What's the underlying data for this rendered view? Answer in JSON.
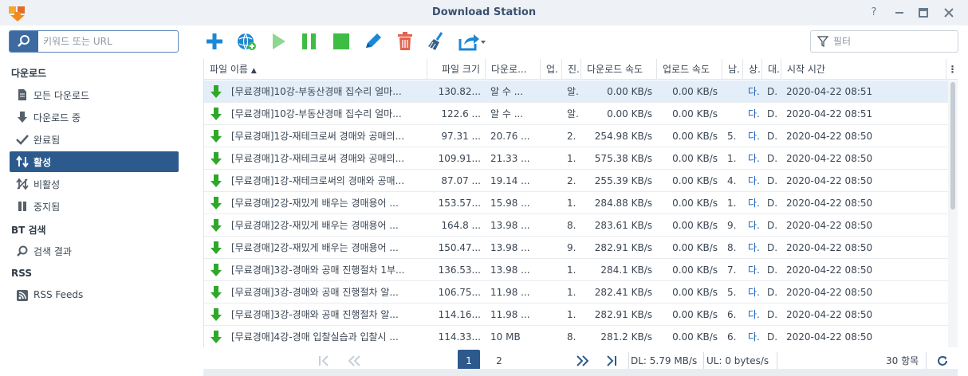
{
  "window": {
    "title": "Download Station"
  },
  "colors": {
    "accent": "#2d5a8c",
    "play_green": "#3dbd44",
    "add_blue": "#1b87d6",
    "trash_red": "#e4624f",
    "arrow_green": "#2fa82a"
  },
  "search": {
    "placeholder": "키워드 또는 URL"
  },
  "filter": {
    "placeholder": "필터"
  },
  "sidebar": {
    "section_download": "다운로드",
    "items": [
      {
        "label": "모든 다운로드",
        "icon": "document-icon"
      },
      {
        "label": "다운로드 중",
        "icon": "down-arrow-icon"
      },
      {
        "label": "완료됨",
        "icon": "check-icon"
      },
      {
        "label": "활성",
        "icon": "up-down-arrows-icon"
      },
      {
        "label": "비활성",
        "icon": "no-transfer-icon"
      },
      {
        "label": "중지됨",
        "icon": "pause-icon"
      }
    ],
    "section_bt": "BT 검색",
    "bt_items": [
      {
        "label": "검색 결과",
        "icon": "magnifier-icon"
      }
    ],
    "section_rss": "RSS",
    "rss_items": [
      {
        "label": "RSS Feeds",
        "icon": "rss-icon"
      }
    ]
  },
  "table": {
    "columns": [
      "파일 이름",
      "파일 크기",
      "다운로...",
      "업.",
      "진.",
      "다운로드 속도",
      "업로드 속도",
      "남.",
      "상.",
      "대.",
      "시작 시간"
    ],
    "sort_indicator": "▲",
    "rows": [
      [
        "[무료경매]10강-부동산경매 집수리 얼마...",
        "130.82...",
        "알 수 ...",
        "",
        "알.",
        "0.00 KB/s",
        "0.00 KB/s",
        "",
        "다.",
        "D.",
        "2020-04-22 08:51"
      ],
      [
        "[무료경매]10강-부동산경매 집수리 얼마...",
        "122.6 ...",
        "알 수 ...",
        "",
        "알.",
        "0.00 KB/s",
        "0.00 KB/s",
        "",
        "다.",
        "D.",
        "2020-04-22 08:51"
      ],
      [
        "[무료경매]1강-재테크로써 경매와 공매의...",
        "97.31 ...",
        "20.76 ...",
        "",
        "2.",
        "254.98 KB/s",
        "0.00 KB/s",
        "5.",
        "다.",
        "D.",
        "2020-04-22 08:50"
      ],
      [
        "[무료경매]1강-재테크로써 경매와 공매의...",
        "109.91...",
        "21.33 ...",
        "",
        "1.",
        "575.38 KB/s",
        "0.00 KB/s",
        "1.",
        "다.",
        "D.",
        "2020-04-22 08:50"
      ],
      [
        "[무료경매]1강-재테크로써의 경매와 공매...",
        "87.07 ...",
        "19.14 ...",
        "",
        "2.",
        "255.39 KB/s",
        "0.00 KB/s",
        "4.",
        "다.",
        "D.",
        "2020-04-22 08:50"
      ],
      [
        "[무료경매]2강-재밌게 배우는 경매용어 ...",
        "153.57...",
        "15.98 ...",
        "",
        "1.",
        "284.88 KB/s",
        "0.00 KB/s",
        "1.",
        "다.",
        "D.",
        "2020-04-22 08:50"
      ],
      [
        "[무료경매]2강-재밌게 배우는 경매용어 ...",
        "164.8 ...",
        "13.98 ...",
        "",
        "8.",
        "283.61 KB/s",
        "0.00 KB/s",
        "9.",
        "다.",
        "D.",
        "2020-04-22 08:50"
      ],
      [
        "[무료경매]2강-재밌게 배우는 경매용어 ...",
        "150.47...",
        "13.98 ...",
        "",
        "9.",
        "282.91 KB/s",
        "0.00 KB/s",
        "8.",
        "다.",
        "D.",
        "2020-04-22 08:50"
      ],
      [
        "[무료경매]3강-경매와 공매 진행절차 1부...",
        "136.53...",
        "13.98 ...",
        "",
        "1.",
        "284.1 KB/s",
        "0.00 KB/s",
        "7.",
        "다.",
        "D.",
        "2020-04-22 08:50"
      ],
      [
        "[무료경매]3강-경매와 공매 진행절차 알...",
        "106.75...",
        "11.98 ...",
        "",
        "1.",
        "282.41 KB/s",
        "0.00 KB/s",
        "5.",
        "다.",
        "D.",
        "2020-04-22 08:50"
      ],
      [
        "[무료경매]3강-경매와 공매 진행절차 알...",
        "114.16...",
        "11.98 ...",
        "",
        "1.",
        "282.91 KB/s",
        "0.00 KB/s",
        "6.",
        "다.",
        "D.",
        "2020-04-22 08:50"
      ],
      [
        "[무료경매]4강-경매 입찰실습과 입찰시 ...",
        "114.33...",
        "10 MB",
        "",
        "8.",
        "281.2 KB/s",
        "0.00 KB/s",
        "6.",
        "다.",
        "D.",
        "2020-04-22 08:50"
      ]
    ]
  },
  "pagination": {
    "pages": [
      "1",
      "2"
    ],
    "current": "1"
  },
  "status": {
    "dl_label": "DL:",
    "dl_value": "5.79 MB/s",
    "ul_label": "UL:",
    "ul_value": "0 bytes/s",
    "count": "30 항목"
  }
}
